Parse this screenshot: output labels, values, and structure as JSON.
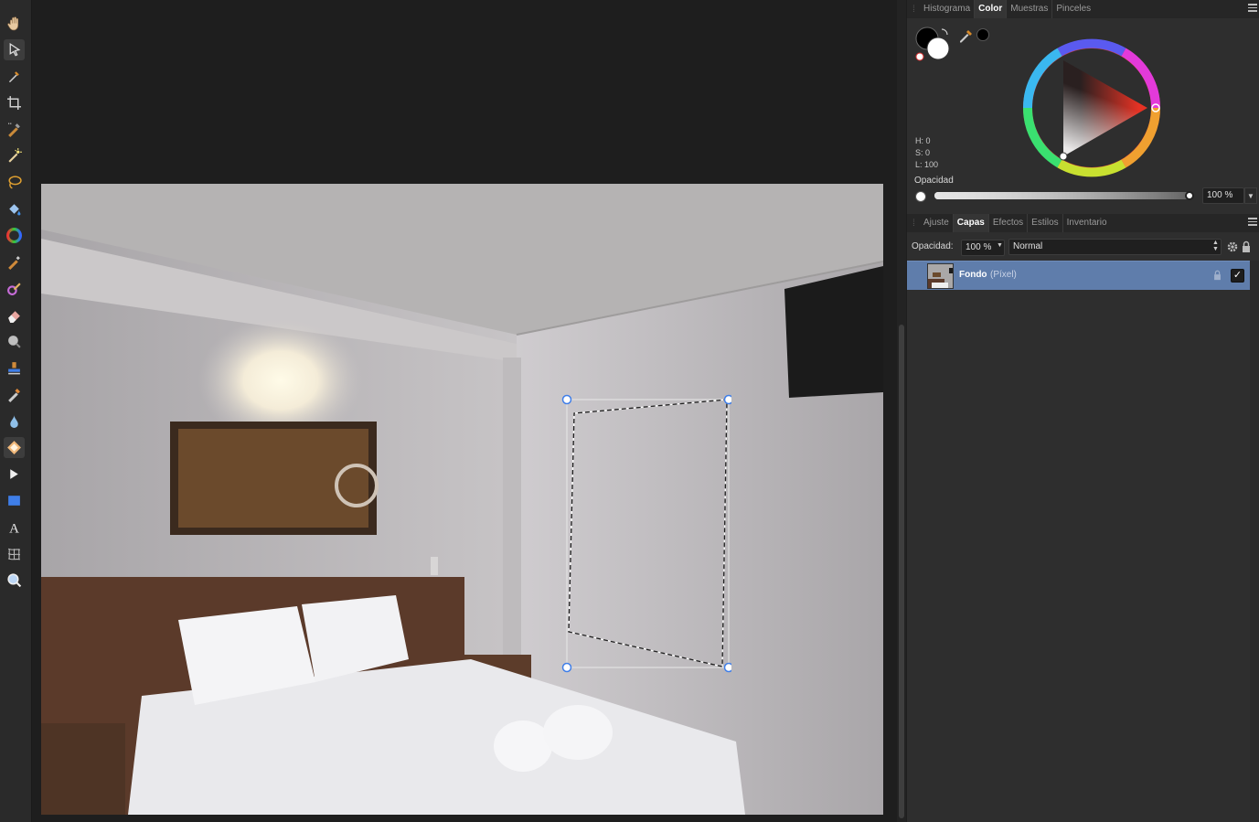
{
  "toolbar": {
    "tools": [
      {
        "name": "hand-tool",
        "icon": "hand-icon"
      },
      {
        "name": "move-tool",
        "icon": "pointer-arrow-icon",
        "active": true
      },
      {
        "name": "color-picker-tool",
        "icon": "eyedropper-icon"
      },
      {
        "name": "crop-tool",
        "icon": "crop-icon"
      },
      {
        "name": "selection-brush-tool",
        "icon": "selection-brush-icon"
      },
      {
        "name": "magic-wand-tool",
        "icon": "magic-wand-icon"
      },
      {
        "name": "freehand-selection-tool",
        "icon": "lasso-icon"
      },
      {
        "name": "flood-fill-tool",
        "icon": "paint-bucket-icon"
      },
      {
        "name": "color-wheel-tool",
        "icon": "color-wheel-icon"
      },
      {
        "name": "paint-brush-tool",
        "icon": "paint-brush-icon"
      },
      {
        "name": "color-replacement-tool",
        "icon": "color-brush-icon"
      },
      {
        "name": "erase-brush-tool",
        "icon": "eraser-icon"
      },
      {
        "name": "dodge-brush-tool",
        "icon": "dodge-icon"
      },
      {
        "name": "clone-brush-tool",
        "icon": "clone-stamp-icon"
      },
      {
        "name": "healing-brush-tool",
        "icon": "healing-brush-icon"
      },
      {
        "name": "blur-brush-tool",
        "icon": "water-drop-icon"
      },
      {
        "name": "inpainting-tool",
        "icon": "inpainting-diamond-icon",
        "highlighted": true
      },
      {
        "name": "node-tool",
        "icon": "node-arrow-icon"
      },
      {
        "name": "rectangle-tool",
        "icon": "rectangle-icon"
      },
      {
        "name": "text-tool",
        "icon": "text-a-icon"
      },
      {
        "name": "mesh-warp-tool",
        "icon": "mesh-warp-icon"
      },
      {
        "name": "zoom-tool",
        "icon": "magnifier-icon"
      }
    ]
  },
  "color_panel": {
    "tabs": [
      "Histograma",
      "Color",
      "Muestras",
      "Pinceles"
    ],
    "active_tab": "Color",
    "h_label": "H: 0",
    "s_label": "S: 0",
    "l_label": "L: 100",
    "opacity_label": "Opacidad",
    "opacity_value": "100 %",
    "opacity": 1.0,
    "primary_color": "#000000",
    "secondary_color": "#ffffff",
    "picked_swatch": "#000000"
  },
  "layers_panel": {
    "tabs": [
      "Ajuste",
      "Capas",
      "Efectos",
      "Estilos",
      "Inventario"
    ],
    "active_tab": "Capas",
    "opacity_label": "Opacidad:",
    "opacity_value": "100 %",
    "blend_mode": "Normal",
    "layers": [
      {
        "name": "Fondo",
        "type": "(Píxel)",
        "visible": true,
        "selected": true
      }
    ]
  },
  "colors": {
    "selection_blue": "#5f7dab",
    "handle_blue": "#3f7ee8"
  }
}
